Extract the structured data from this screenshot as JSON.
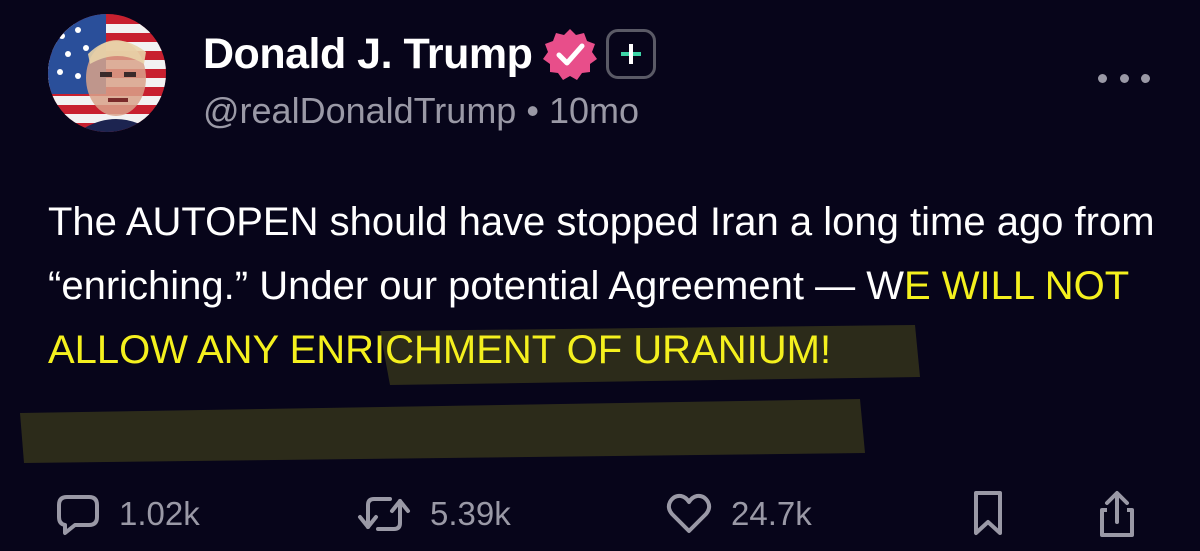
{
  "post": {
    "author": {
      "display_name": "Donald J. Trump",
      "handle": "@realDonaldTrump",
      "verified": true,
      "avatar": "flag-portrait-avatar"
    },
    "separator": "•",
    "timestamp": "10mo",
    "text_plain": "The AUTOPEN should have stopped Iran a long time ago from “enriching.” Under our potential Agreement — W",
    "text_highlighted": "E WILL NOT ALLOW ANY ENRICHMENT OF URANIUM!",
    "highlight_color": "#f4f01e",
    "verified_color": "#e84e8a"
  },
  "actions": {
    "replies": "1.02k",
    "reposts": "5.39k",
    "likes": "24.7k"
  },
  "icons": {
    "more": "more-horizontal-icon",
    "plus": "plus-badge-icon",
    "reply": "reply-bubble-icon",
    "repost": "repost-icon",
    "like": "heart-icon",
    "bookmark": "bookmark-icon",
    "share": "share-icon"
  }
}
